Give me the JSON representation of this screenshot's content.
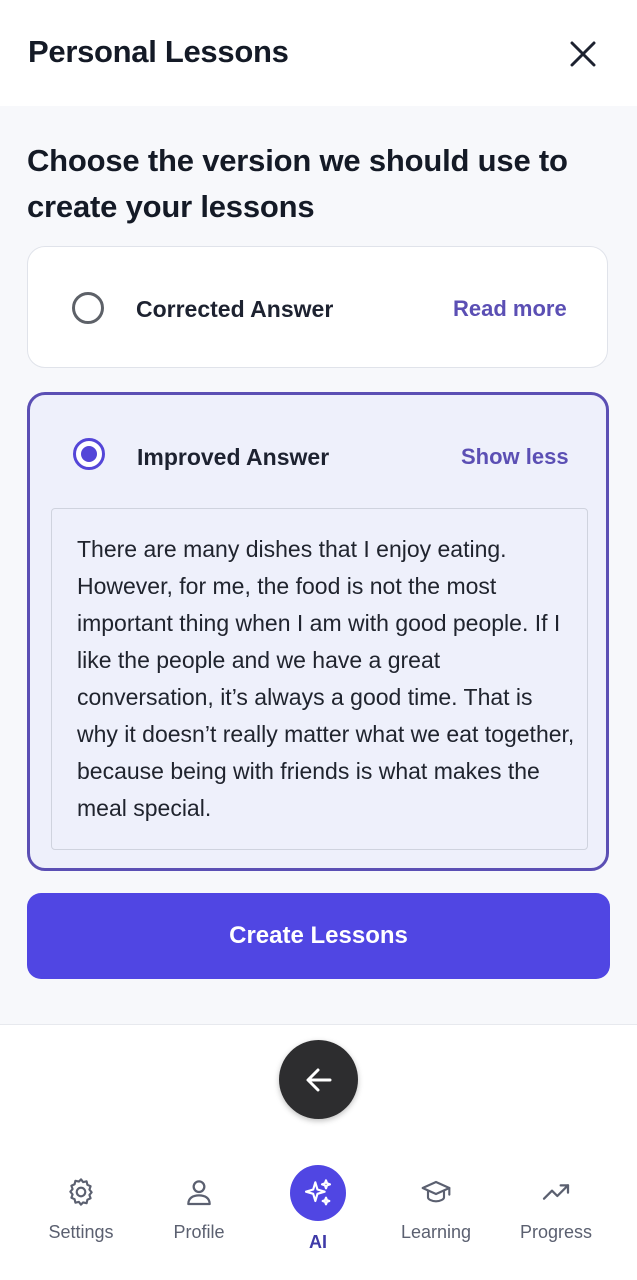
{
  "header": {
    "title": "Personal Lessons",
    "close_icon": "close-icon"
  },
  "main": {
    "question": "Choose the version we should use to create your lessons",
    "options": [
      {
        "label": "Corrected Answer",
        "link": "Read more",
        "selected": false
      },
      {
        "label": "Improved Answer",
        "link": "Show less",
        "selected": true,
        "text": "There are many dishes that I enjoy eating. However, for me, the food is not the most important thing when I am with good people. If I like the people and we have a great conversation, it’s always a good time. That is why it doesn’t really matter what we eat together, because being with friends is what makes the meal special."
      }
    ],
    "create_button": "Create Lessons"
  },
  "back_button": {
    "icon": "arrow-left-icon"
  },
  "nav": {
    "items": [
      {
        "label": "Settings",
        "icon": "gear-icon"
      },
      {
        "label": "Profile",
        "icon": "person-icon"
      },
      {
        "label": "AI",
        "icon": "sparkles-icon",
        "active": true
      },
      {
        "label": "Learning",
        "icon": "graduation-cap-icon"
      },
      {
        "label": "Progress",
        "icon": "trending-up-icon"
      }
    ]
  },
  "colors": {
    "accent": "#5046E3",
    "link": "#5B4FB4",
    "fab": "#2D2D2F"
  }
}
